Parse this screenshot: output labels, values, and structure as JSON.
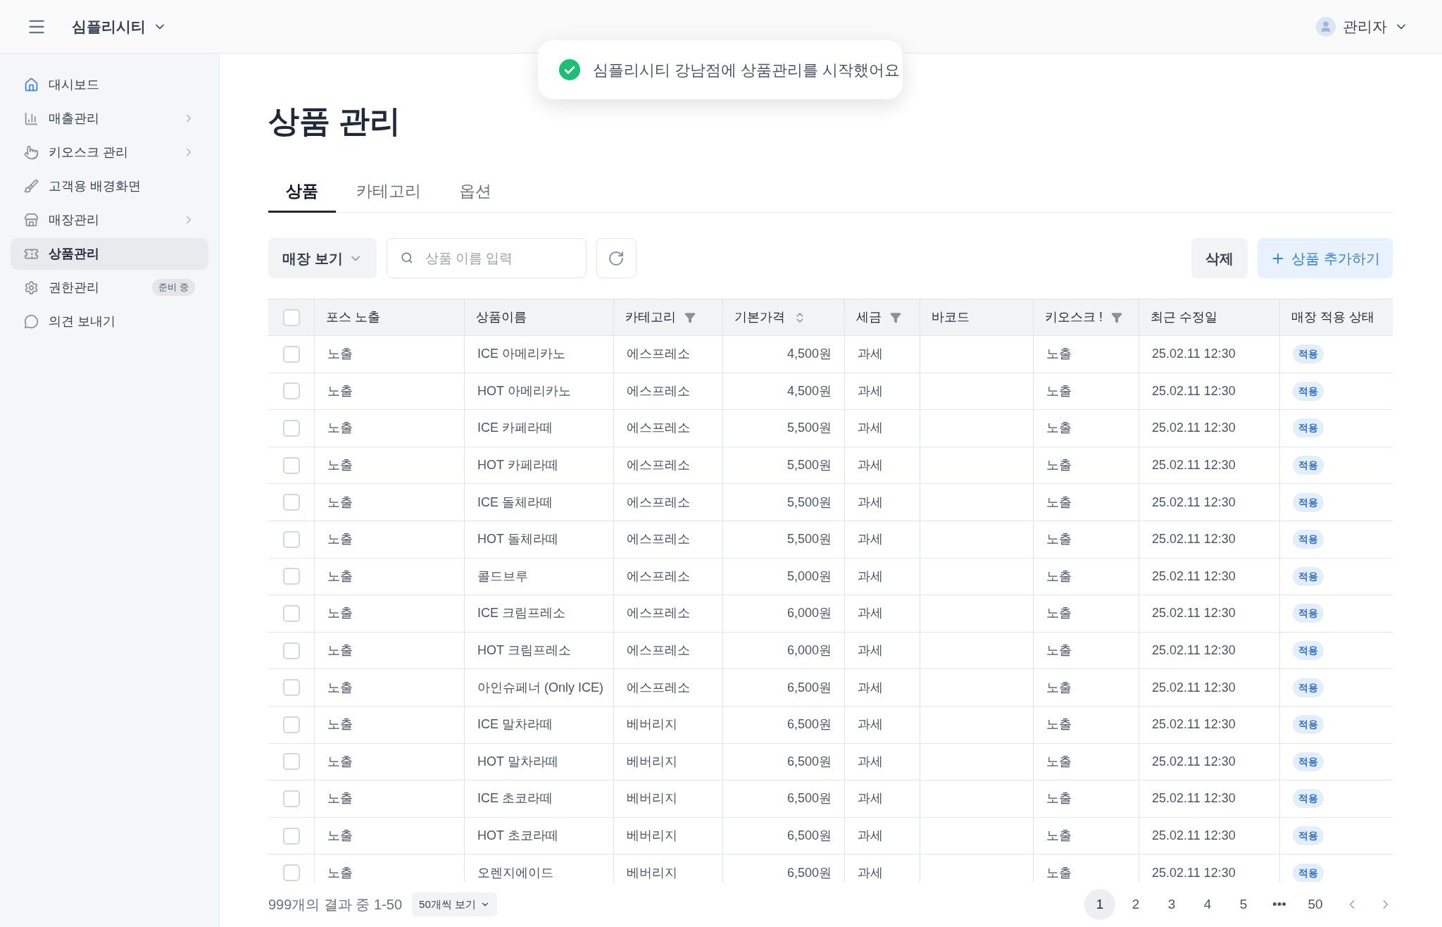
{
  "header": {
    "brand": "심플리시티",
    "user": "관리자"
  },
  "toast": {
    "message": "심플리시티 강남점에 상품관리를 시작했어요"
  },
  "sidebar": {
    "items": [
      {
        "kind": "home",
        "label": "대시보드",
        "selected": false,
        "expandable": false
      },
      {
        "kind": "chart",
        "label": "매출관리",
        "selected": false,
        "expandable": true
      },
      {
        "kind": "hand",
        "label": "키오스크 관리",
        "selected": false,
        "expandable": true
      },
      {
        "kind": "brush",
        "label": "고객용 배경화면",
        "selected": false,
        "expandable": false
      },
      {
        "kind": "store",
        "label": "매장관리",
        "selected": false,
        "expandable": true
      },
      {
        "kind": "ticket",
        "label": "상품관리",
        "selected": true,
        "expandable": false
      },
      {
        "kind": "gear",
        "label": "권한관리",
        "selected": false,
        "expandable": false,
        "badge": "준비 중"
      },
      {
        "kind": "bubble",
        "label": "의견 보내기",
        "selected": false,
        "expandable": false
      }
    ]
  },
  "page": {
    "title": "상품 관리"
  },
  "tabs": [
    {
      "label": "상품",
      "selected": true
    },
    {
      "label": "카테고리",
      "selected": false
    },
    {
      "label": "옵션",
      "selected": false
    }
  ],
  "toolbar": {
    "view_dropdown": "매장 보기",
    "search": {
      "placeholder": "상품 이름 입력"
    },
    "delete_button": "삭제",
    "add_button": "상품 추가하기"
  },
  "table": {
    "columns": [
      {
        "label": "포스 노출",
        "kind": "plain"
      },
      {
        "label": "상품이름",
        "kind": "plain"
      },
      {
        "label": "카테고리",
        "kind": "filter"
      },
      {
        "label": "기본가격",
        "kind": "sort"
      },
      {
        "label": "세금",
        "kind": "filter"
      },
      {
        "label": "바코드",
        "kind": "plain"
      },
      {
        "label": "키오스크 !",
        "kind": "filter"
      },
      {
        "label": "최근 수정일",
        "kind": "plain"
      },
      {
        "label": "매장 적용 상태",
        "kind": "plain"
      }
    ],
    "all_checked": false,
    "rows": [
      {
        "checked": false,
        "pos": "노출",
        "name": "ICE 아메리카노",
        "category": "에스프레소",
        "price": "4,500원",
        "tax": "과세",
        "kiosk": "노출",
        "updated": "25.02.11 12:30",
        "status": "적용"
      },
      {
        "checked": false,
        "pos": "노출",
        "name": "HOT 아메리카노",
        "category": "에스프레소",
        "price": "4,500원",
        "tax": "과세",
        "kiosk": "노출",
        "updated": "25.02.11 12:30",
        "status": "적용"
      },
      {
        "checked": false,
        "pos": "노출",
        "name": "ICE 카페라떼",
        "category": "에스프레소",
        "price": "5,500원",
        "tax": "과세",
        "kiosk": "노출",
        "updated": "25.02.11 12:30",
        "status": "적용"
      },
      {
        "checked": false,
        "pos": "노출",
        "name": "HOT 카페라떼",
        "category": "에스프레소",
        "price": "5,500원",
        "tax": "과세",
        "kiosk": "노출",
        "updated": "25.02.11 12:30",
        "status": "적용"
      },
      {
        "checked": false,
        "pos": "노출",
        "name": "ICE 돌체라떼",
        "category": "에스프레소",
        "price": "5,500원",
        "tax": "과세",
        "kiosk": "노출",
        "updated": "25.02.11 12:30",
        "status": "적용"
      },
      {
        "checked": false,
        "pos": "노출",
        "name": "HOT 돌체라떼",
        "category": "에스프레소",
        "price": "5,500원",
        "tax": "과세",
        "kiosk": "노출",
        "updated": "25.02.11 12:30",
        "status": "적용"
      },
      {
        "checked": false,
        "pos": "노출",
        "name": "콜드브루",
        "category": "에스프레소",
        "price": "5,000원",
        "tax": "과세",
        "kiosk": "노출",
        "updated": "25.02.11 12:30",
        "status": "적용"
      },
      {
        "checked": false,
        "pos": "노출",
        "name": "ICE 크림프레소",
        "category": "에스프레소",
        "price": "6,000원",
        "tax": "과세",
        "kiosk": "노출",
        "updated": "25.02.11 12:30",
        "status": "적용"
      },
      {
        "checked": false,
        "pos": "노출",
        "name": "HOT 크림프레소",
        "category": "에스프레소",
        "price": "6,000원",
        "tax": "과세",
        "kiosk": "노출",
        "updated": "25.02.11 12:30",
        "status": "적용"
      },
      {
        "checked": false,
        "pos": "노출",
        "name": "아인슈페너 (Only ICE)",
        "category": "에스프레소",
        "price": "6,500원",
        "tax": "과세",
        "kiosk": "노출",
        "updated": "25.02.11 12:30",
        "status": "적용"
      },
      {
        "checked": false,
        "pos": "노출",
        "name": "ICE 말차라떼",
        "category": "베버리지",
        "price": "6,500원",
        "tax": "과세",
        "kiosk": "노출",
        "updated": "25.02.11 12:30",
        "status": "적용"
      },
      {
        "checked": false,
        "pos": "노출",
        "name": "HOT 말차라떼",
        "category": "베버리지",
        "price": "6,500원",
        "tax": "과세",
        "kiosk": "노출",
        "updated": "25.02.11 12:30",
        "status": "적용"
      },
      {
        "checked": false,
        "pos": "노출",
        "name": "ICE 초코라떼",
        "category": "베버리지",
        "price": "6,500원",
        "tax": "과세",
        "kiosk": "노출",
        "updated": "25.02.11 12:30",
        "status": "적용"
      },
      {
        "checked": false,
        "pos": "노출",
        "name": "HOT 초코라떼",
        "category": "베버리지",
        "price": "6,500원",
        "tax": "과세",
        "kiosk": "노출",
        "updated": "25.02.11 12:30",
        "status": "적용"
      },
      {
        "checked": false,
        "pos": "노출",
        "name": "오렌지에이드",
        "category": "베버리지",
        "price": "6,500원",
        "tax": "과세",
        "kiosk": "노출",
        "updated": "25.02.11 12:30",
        "status": "적용"
      }
    ]
  },
  "footer": {
    "summary": "999개의 결과 중 1-50",
    "page_size": "50개씩 보기",
    "pages": [
      {
        "label": "1",
        "selected": true
      },
      {
        "label": "2",
        "selected": false
      },
      {
        "label": "3",
        "selected": false
      },
      {
        "label": "4",
        "selected": false
      },
      {
        "label": "5",
        "selected": false
      },
      {
        "label": "•••",
        "selected": false
      },
      {
        "label": "50",
        "selected": false
      }
    ]
  }
}
